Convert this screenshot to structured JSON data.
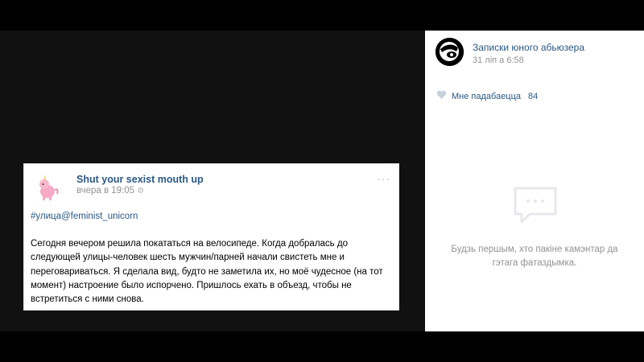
{
  "post": {
    "author": "Shut your sexist mouth up",
    "time": "вчера в 19:05",
    "more": "···",
    "tag": "#улица@feminist_unicorn",
    "text": "Сегодня вечером решила покататься на велосипеде. Когда добралась до следующей улицы-человек шесть мужчин/парней начали свистеть мне и переговариваться. Я сделала вид, будто не заметила их, но моё чудесное (на тот момент) настроение было испорчено. Пришлось ехать в объезд, чтобы не встретиться с ними снова."
  },
  "sidebar": {
    "title": "Записки юного абьюзера",
    "date": "31 ліп а 6:58",
    "like_label": "Мне падабаецца",
    "like_count": "84",
    "empty_line1": "Будзь першым, хто пакіне камэнтар да",
    "empty_line2": "гэтага фатаздымка."
  },
  "icons": {
    "post_avatar": "pink-unicorn-icon",
    "side_avatar": "black-white-avatar-icon",
    "like": "heart-icon",
    "empty_comments": "comment-bubble-icon",
    "time_extra": "gear-icon"
  },
  "colors": {
    "link": "#2a5885",
    "muted": "#939393",
    "background": "#000000"
  }
}
